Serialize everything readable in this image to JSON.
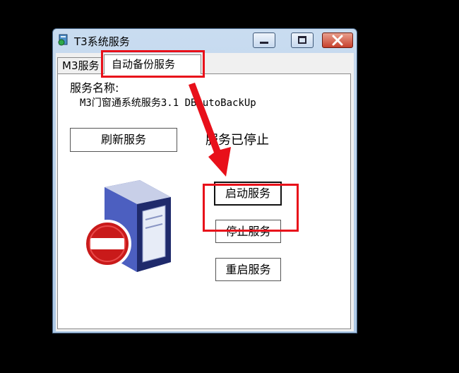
{
  "window": {
    "title": "T3系统服务",
    "controls": {
      "minimize": "minimize",
      "maximize": "maximize",
      "close": "close"
    }
  },
  "tabs": [
    {
      "label": "M3服务",
      "active": false
    },
    {
      "label": "自动备份服务",
      "active": true
    }
  ],
  "service": {
    "name_label": "服务名称:",
    "name_value": "M3门窗通系统服务3.1 DBAutoBackUp",
    "status": "服务已停止"
  },
  "buttons": {
    "refresh": "刷新服务",
    "start": "启动服务",
    "stop": "停止服务",
    "restart": "重启服务"
  },
  "icons": {
    "app": "service-app-icon",
    "server": "server-stopped-icon",
    "annotation": "red-arrow-annotation"
  },
  "colors": {
    "highlight": "#e8101a",
    "close_button": "#c7402c"
  }
}
